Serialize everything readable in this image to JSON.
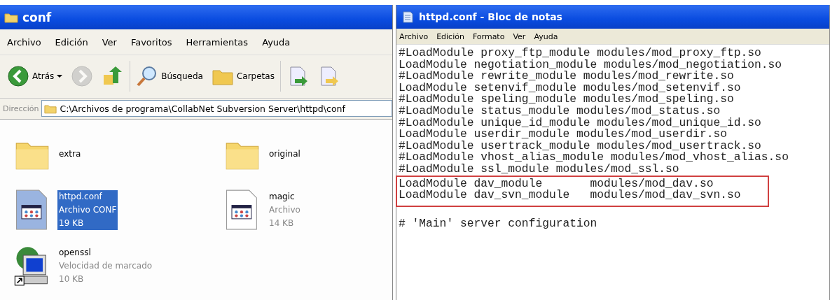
{
  "explorer": {
    "title": "conf",
    "menu": [
      "Archivo",
      "Edición",
      "Ver",
      "Favoritos",
      "Herramientas",
      "Ayuda"
    ],
    "toolbar": [
      {
        "kind": "back",
        "label": "Atrás",
        "disabled": false
      },
      {
        "kind": "forward",
        "disabled": true
      },
      {
        "kind": "up",
        "disabled": false
      },
      {
        "kind": "search",
        "label": "Búsqueda",
        "disabled": false
      },
      {
        "kind": "folders",
        "label": "Carpetas",
        "disabled": false
      },
      {
        "kind": "move",
        "disabled": false
      },
      {
        "kind": "copy",
        "disabled": false
      }
    ],
    "address": {
      "label": "Dirección",
      "value": "C:\\Archivos de programa\\CollabNet Subversion Server\\httpd\\conf"
    },
    "items": [
      {
        "kind": "folder",
        "name": "extra",
        "selected": false
      },
      {
        "kind": "folder",
        "name": "original",
        "selected": false
      },
      {
        "kind": "file",
        "name": "httpd.conf",
        "type": "Archivo CONF",
        "size": "19 KB",
        "selected": true
      },
      {
        "kind": "file",
        "name": "magic",
        "type": "Archivo",
        "size": "14 KB",
        "selected": false
      },
      {
        "kind": "shortcut",
        "name": "openssl",
        "type": "Velocidad de marcado",
        "size": "10 KB",
        "selected": false
      }
    ]
  },
  "notepad": {
    "title": "httpd.conf - Bloc de notas",
    "menu": [
      "Archivo",
      "Edición",
      "Formato",
      "Ver",
      "Ayuda"
    ],
    "lines": [
      {
        "text": "#LoadModule proxy_ftp_module modules/mod_proxy_ftp.so",
        "boxed": false
      },
      {
        "text": "LoadModule negotiation_module modules/mod_negotiation.so",
        "boxed": false
      },
      {
        "text": "#LoadModule rewrite_module modules/mod_rewrite.so",
        "boxed": false
      },
      {
        "text": "LoadModule setenvif_module modules/mod_setenvif.so",
        "boxed": false
      },
      {
        "text": "#LoadModule speling_module modules/mod_speling.so",
        "boxed": false
      },
      {
        "text": "#LoadModule status_module modules/mod_status.so",
        "boxed": false
      },
      {
        "text": "#LoadModule unique_id_module modules/mod_unique_id.so",
        "boxed": false
      },
      {
        "text": "LoadModule userdir_module modules/mod_userdir.so",
        "boxed": false
      },
      {
        "text": "#LoadModule usertrack_module modules/mod_usertrack.so",
        "boxed": false
      },
      {
        "text": "#LoadModule vhost_alias_module modules/mod_vhost_alias.so",
        "boxed": false
      },
      {
        "text": "#LoadModule ssl_module modules/mod_ssl.so",
        "boxed": false
      },
      {
        "text": "LoadModule dav_module       modules/mod_dav.so",
        "boxed": true
      },
      {
        "text": "LoadModule dav_svn_module   modules/mod_dav_svn.so",
        "boxed": true
      },
      {
        "boxed": false
      },
      {
        "text": "# 'Main' server configuration",
        "boxed": false
      }
    ]
  }
}
